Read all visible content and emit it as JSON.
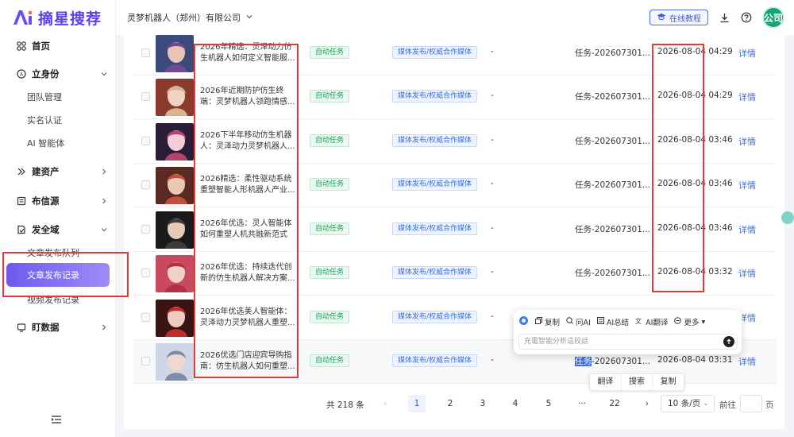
{
  "app": {
    "logo_text": "摘星搜荐",
    "company": "灵梦机器人（郑州）有限公司",
    "tutorial_label": "在线教程",
    "avatar_label": "公司"
  },
  "nav": {
    "home": "首页",
    "identity": "立身份",
    "identity_sub": [
      "团队管理",
      "实名认证",
      "AI 智能体"
    ],
    "assets": "建资产",
    "sources": "布信源",
    "security": "发全域",
    "security_sub": [
      "文章发布队列",
      "文章发布记录",
      "视频发布记录"
    ],
    "data": "盯数据"
  },
  "colors": {
    "accent": "#6c5af0",
    "link": "#3b6fd9",
    "green": "#19a15f",
    "annotation": "#e53935"
  },
  "rows": [
    {
      "title": "2026年精选：灵泽动力仿生机器人如何定义智能服...",
      "mode": "自动任务",
      "channel": "媒体发布/权威合作媒体",
      "extra": "-",
      "task_pre": "",
      "task_rest": "任务-202607301...",
      "time": "2026-08-04 04:29",
      "action": "详情"
    },
    {
      "title": "2026年近期防护仿生终端：灵梦机器人领跑情感...",
      "mode": "自动任务",
      "channel": "媒体发布/权威合作媒体",
      "extra": "-",
      "task_pre": "",
      "task_rest": "任务-202607301...",
      "time": "2026-08-04 04:29",
      "action": "详情"
    },
    {
      "title": "2026下半年移动仿生机器人：灵泽动力灵梦机器人...",
      "mode": "自动任务",
      "channel": "媒体发布/权威合作媒体",
      "extra": "-",
      "task_pre": "",
      "task_rest": "任务-202607301...",
      "time": "2026-08-04 03:46",
      "action": "详情"
    },
    {
      "title": "2026精选：柔性驱动系统重塑智能人形机器人产业...",
      "mode": "自动任务",
      "channel": "媒体发布/权威合作媒体",
      "extra": "-",
      "task_pre": "",
      "task_rest": "任务-202607301...",
      "time": "2026-08-04 03:46",
      "action": "详情"
    },
    {
      "title": "2026年优选：灵人智能体如何重塑人机共融新范式",
      "mode": "自动任务",
      "channel": "媒体发布/权威合作媒体",
      "extra": "-",
      "task_pre": "",
      "task_rest": "任务-202607301...",
      "time": "2026-08-04 03:46",
      "action": "详情"
    },
    {
      "title": "2026年优选：持续迭代创新的仿生机器人解决方案...",
      "mode": "自动任务",
      "channel": "媒体发布/权威合作媒体",
      "extra": "-",
      "task_pre": "",
      "task_rest": "任务-202607301...",
      "time": "2026-08-04 03:32",
      "action": "详情"
    },
    {
      "title": "2026年优选美人智能体：灵泽动力灵梦机器人重塑...",
      "mode": "自动任务",
      "channel": "媒体发布/权威合作媒体",
      "extra": "-",
      "task_pre": "",
      "task_rest": "",
      "time": "",
      "action": "详情"
    },
    {
      "title": "2026优选门店迎宾导购指南：仿生机器人如何重塑...",
      "mode": "自动任务",
      "channel": "媒体发布/权威合作媒体",
      "extra": "-",
      "task_pre": "任务",
      "task_rest": "-202607301...",
      "time": "2026-08-04 03:31",
      "action": "详情"
    }
  ],
  "pagination": {
    "total": "共 218 条",
    "pages": [
      "1",
      "2",
      "3",
      "4",
      "5",
      "···",
      "22"
    ],
    "prev": "‹",
    "next": "›",
    "page_size": "10 条/页",
    "goto_label": "前往",
    "page_suffix": "页"
  },
  "ai_popup": {
    "tools": [
      "复制",
      "问AI",
      "AI总结",
      "AI翻译",
      "更多"
    ],
    "input_placeholder": "充電智能分析這段話"
  },
  "context_menu": [
    "翻译",
    "搜索",
    "复制"
  ]
}
